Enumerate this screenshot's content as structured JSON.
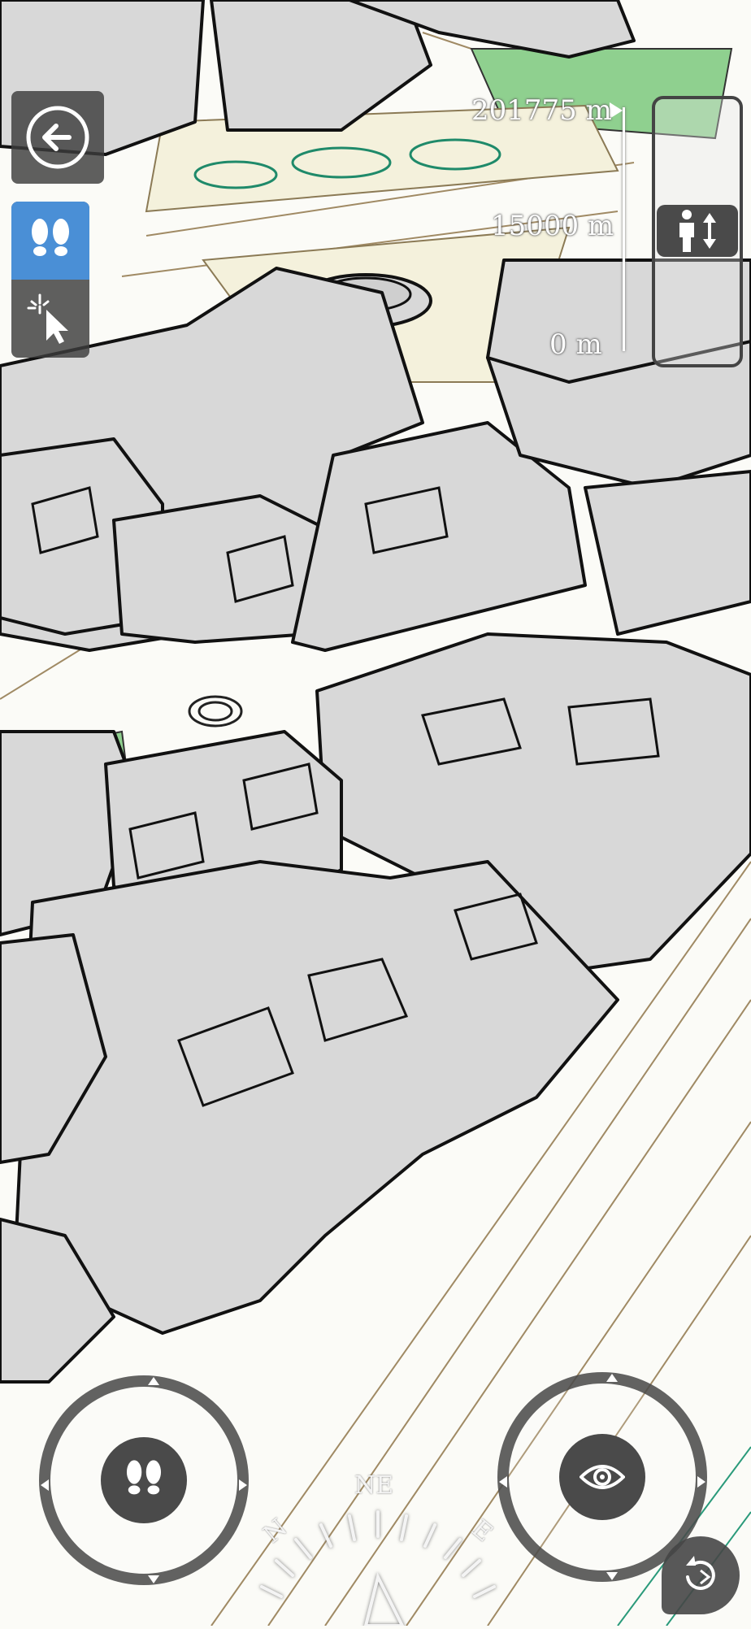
{
  "toolbar": {
    "back_icon": "arrow-left-icon",
    "walk_mode_icon": "footsteps-icon",
    "select_mode_icon": "pointer-sparkle-icon",
    "walk_mode_active": true
  },
  "altimeter": {
    "top_label": "201775 m",
    "mid_label": "15000 m",
    "bottom_label": "0 m",
    "height_icon": "person-up-down-icon"
  },
  "move_joystick": {
    "icon": "footsteps-icon"
  },
  "look_joystick": {
    "icon": "eye-icon",
    "reset_icon": "rotate-reset-icon"
  },
  "compass": {
    "ne_label": "NE",
    "n_label": "N",
    "e_label": "E"
  },
  "colors": {
    "panel": "#3c3c3c",
    "accent": "#4a8fd6",
    "park": "#8fd08f",
    "building": "#d8d8d8"
  }
}
